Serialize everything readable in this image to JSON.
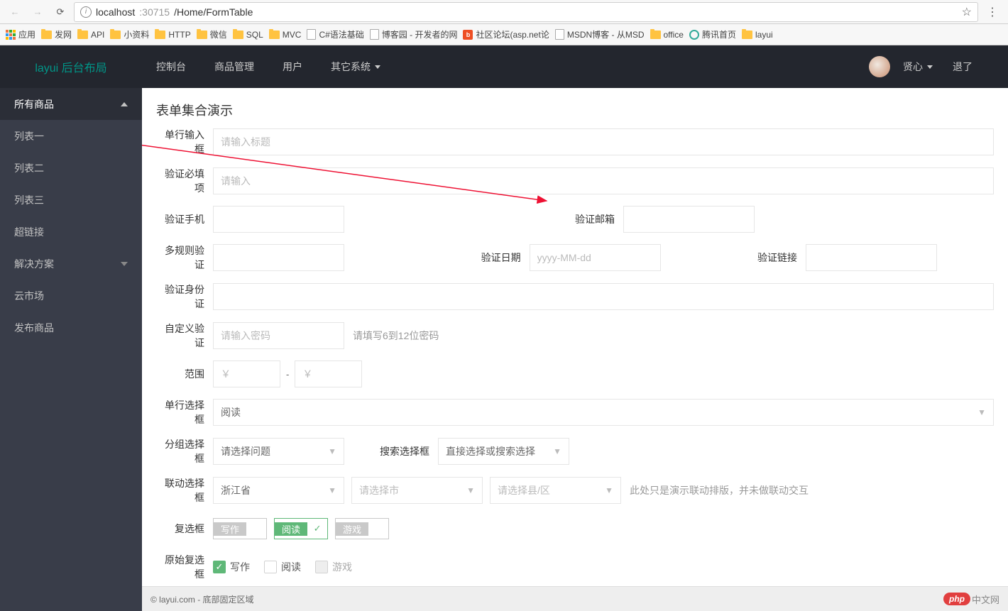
{
  "browser": {
    "url_host": "localhost",
    "url_port": ":30715",
    "url_path": "/Home/FormTable"
  },
  "bookmarks": {
    "apps": "应用",
    "items": [
      {
        "label": "发网",
        "type": "folder"
      },
      {
        "label": "API",
        "type": "folder"
      },
      {
        "label": "小资料",
        "type": "folder"
      },
      {
        "label": "HTTP",
        "type": "folder"
      },
      {
        "label": "微信",
        "type": "folder"
      },
      {
        "label": "SQL",
        "type": "folder"
      },
      {
        "label": "MVC",
        "type": "folder"
      },
      {
        "label": "C#语法基础",
        "type": "page"
      },
      {
        "label": "博客园 - 开发者的网",
        "type": "page"
      },
      {
        "label": "社区论坛(asp.net论",
        "type": "bd"
      },
      {
        "label": "MSDN博客 - 从MSD",
        "type": "page"
      },
      {
        "label": "office",
        "type": "folder"
      },
      {
        "label": "腾讯首页",
        "type": "360"
      },
      {
        "label": "layui",
        "type": "folder"
      }
    ]
  },
  "header": {
    "logo": "layui 后台布局",
    "nav": [
      "控制台",
      "商品管理",
      "用户",
      "其它系统"
    ],
    "user": "贤心",
    "logout": "退了"
  },
  "sidebar": {
    "items": [
      {
        "label": "所有商品",
        "type": "header",
        "arrow": "up"
      },
      {
        "label": "列表一",
        "type": "sub"
      },
      {
        "label": "列表二",
        "type": "sub"
      },
      {
        "label": "列表三",
        "type": "sub"
      },
      {
        "label": "超链接",
        "type": "sub"
      },
      {
        "label": "解决方案",
        "type": "item",
        "arrow": "down"
      },
      {
        "label": "云市场",
        "type": "item"
      },
      {
        "label": "发布商品",
        "type": "item"
      }
    ]
  },
  "page": {
    "title": "表单集合演示"
  },
  "form": {
    "single_input_label": "单行输入框",
    "single_input_ph": "请输入标题",
    "required_label": "验证必填项",
    "required_ph": "请输入",
    "phone_label": "验证手机",
    "email_label": "验证邮箱",
    "multi_rule_label": "多规则验证",
    "date_label": "验证日期",
    "date_ph": "yyyy-MM-dd",
    "link_label": "验证链接",
    "id_label": "验证身份证",
    "custom_label": "自定义验证",
    "custom_ph": "请输入密码",
    "custom_hint": "请填写6到12位密码",
    "range_label": "范围",
    "range_ph": "￥",
    "range_dash": "-",
    "single_select_label": "单行选择框",
    "single_select_val": "阅读",
    "group_select_label": "分组选择框",
    "group_select_val": "请选择问题",
    "search_select_label": "搜索选择框",
    "search_select_val": "直接选择或搜索选择",
    "cascade_label": "联动选择框",
    "cascade_province": "浙江省",
    "cascade_city": "请选择市",
    "cascade_district": "请选择县/区",
    "cascade_hint": "此处只是演示联动排版，并未做联动交互",
    "checkbox_label": "复选框",
    "chk_write": "写作",
    "chk_read": "阅读",
    "chk_game": "游戏",
    "raw_checkbox_label": "原始复选框",
    "raw_write": "写作",
    "raw_read": "阅读",
    "raw_game": "游戏"
  },
  "footer": {
    "text": "© layui.com - 底部固定区域",
    "badge": "php",
    "badge_text": "中文网"
  }
}
